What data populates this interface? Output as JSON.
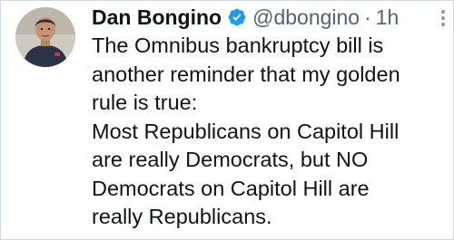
{
  "tweet": {
    "author": {
      "display_name": "Dan Bongino",
      "handle": "@dbongino",
      "verified": true,
      "avatar_icon": "profile-photo"
    },
    "separator": "·",
    "timestamp": "1h",
    "more_icon": "more-vertical-icon",
    "text_lines": [
      "The Omnibus bankruptcy bill is",
      "another reminder that my golden",
      "rule is true:",
      "Most Republicans on Capitol Hill",
      "are really Democrats, but NO",
      "Democrats on Capitol Hill are",
      "really Republicans."
    ]
  },
  "colors": {
    "text": "#0f1419",
    "secondary": "#536471",
    "verified_badge": "#1d9bf0",
    "border": "#cfd9de"
  }
}
